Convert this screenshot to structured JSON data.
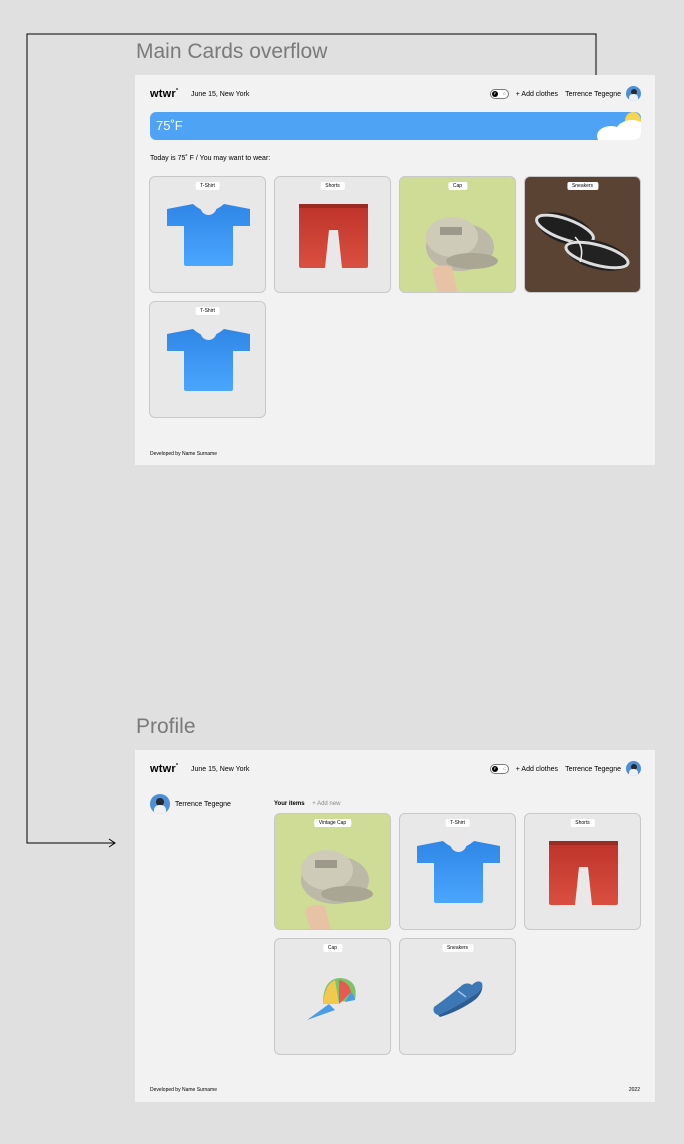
{
  "frames": {
    "main_title": "Main Cards overflow",
    "profile_title": "Profile"
  },
  "header": {
    "logo": "wtwr",
    "logo_mark": "°",
    "date_location": "June 15, New York",
    "toggle_f": "F",
    "toggle_c": "C",
    "add_clothes": "+ Add clothes",
    "username": "Terrence Tegegne"
  },
  "weather": {
    "temperature": "75˚F",
    "accent_color": "#4ea3f5"
  },
  "main": {
    "recommendation": "Today is 75˚ F / You may want to wear:",
    "cards": [
      {
        "label": "T-Shirt",
        "kind": "tshirt-icon"
      },
      {
        "label": "Shorts",
        "kind": "shorts-icon"
      },
      {
        "label": "Cap",
        "kind": "cap-photo"
      },
      {
        "label": "Sneakers",
        "kind": "sneakers-photo"
      },
      {
        "label": "T-Shirt",
        "kind": "tshirt-icon"
      }
    ],
    "footer": "Developed by Name Surname"
  },
  "profile": {
    "name": "Terrence Tegegne",
    "tab_items": "Your items",
    "tab_add": "+ Add new",
    "cards": [
      {
        "label": "Vintage Cap",
        "kind": "cap-photo"
      },
      {
        "label": "T-Shirt",
        "kind": "tshirt-icon"
      },
      {
        "label": "Shorts",
        "kind": "shorts-icon"
      },
      {
        "label": "Cap",
        "kind": "cap-icon"
      },
      {
        "label": "Sneakers",
        "kind": "sneakers-icon"
      }
    ],
    "footer_left": "Developed by Name Surname",
    "footer_right": "2022"
  }
}
